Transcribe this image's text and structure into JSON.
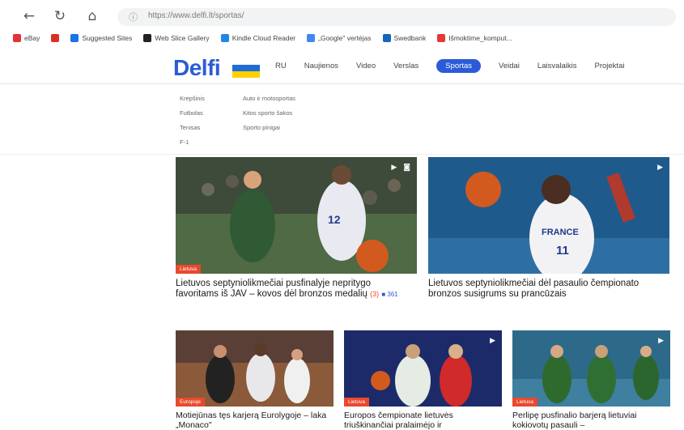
{
  "browser": {
    "url": "https://www.delfi.lt/sportas/",
    "back_icon": "←",
    "reload_icon": "↻",
    "home_icon": "⌂",
    "lock_icon": "ⓘ",
    "bookmarks": [
      {
        "label": "eBay",
        "color": "#e53238"
      },
      {
        "label": "",
        "color": "#d93025"
      },
      {
        "label": "Suggested Sites",
        "color": "#1a73e8"
      },
      {
        "label": "Web Slice Gallery",
        "color": "#222222"
      },
      {
        "label": "Kindle Cloud Reader",
        "color": "#1e88e5"
      },
      {
        "label": "„Google\" vertėjas",
        "color": "#4285f4"
      },
      {
        "label": "Swedbank",
        "color": "#1565c0"
      },
      {
        "label": "Išmoktime_komput...",
        "color": "#e53935"
      }
    ]
  },
  "site": {
    "logo": "Delfi",
    "menu": [
      "RU",
      "Naujienos",
      "Video",
      "Verslas",
      "Sportas",
      "Veidai",
      "Laisvalaikis",
      "Projektai"
    ],
    "active_menu": "Sportas",
    "submenu_col1": [
      "Krepšinis",
      "Futbolas",
      "Tenisas",
      "F-1"
    ],
    "submenu_col2": [
      "Auto ir motosportas",
      "Kitos sporto šakos",
      "Sporto pinigai"
    ]
  },
  "articles": {
    "a1": {
      "tag": "Lietuva",
      "title": "Lietuvos septyniolikmečiai pusfinalyje nepritygo favoritams iš JAV – kovos dėl bronzos medalių",
      "comments": "(3)",
      "extra": "361"
    },
    "a2": {
      "title": "Lietuvos septyniolikmečiai dėl pasaulio čempionato bronzos susigrums su prancūzais"
    },
    "a3": {
      "tag": "Europoje",
      "title": "Motiejūnas tęs karjerą Eurolygoje – laka „Monaco\""
    },
    "a4": {
      "tag": "Lietuva",
      "title": "Europos čempionate lietuvės triuškinančiai pralaimėjo ir"
    },
    "a5": {
      "tag": "Lietuva",
      "title": "Perlipę pusfinalio barjerą lietuviai kokiovotų pasauli –"
    }
  },
  "colors": {
    "accent": "#2b5bd7",
    "tag": "#e8492e"
  }
}
